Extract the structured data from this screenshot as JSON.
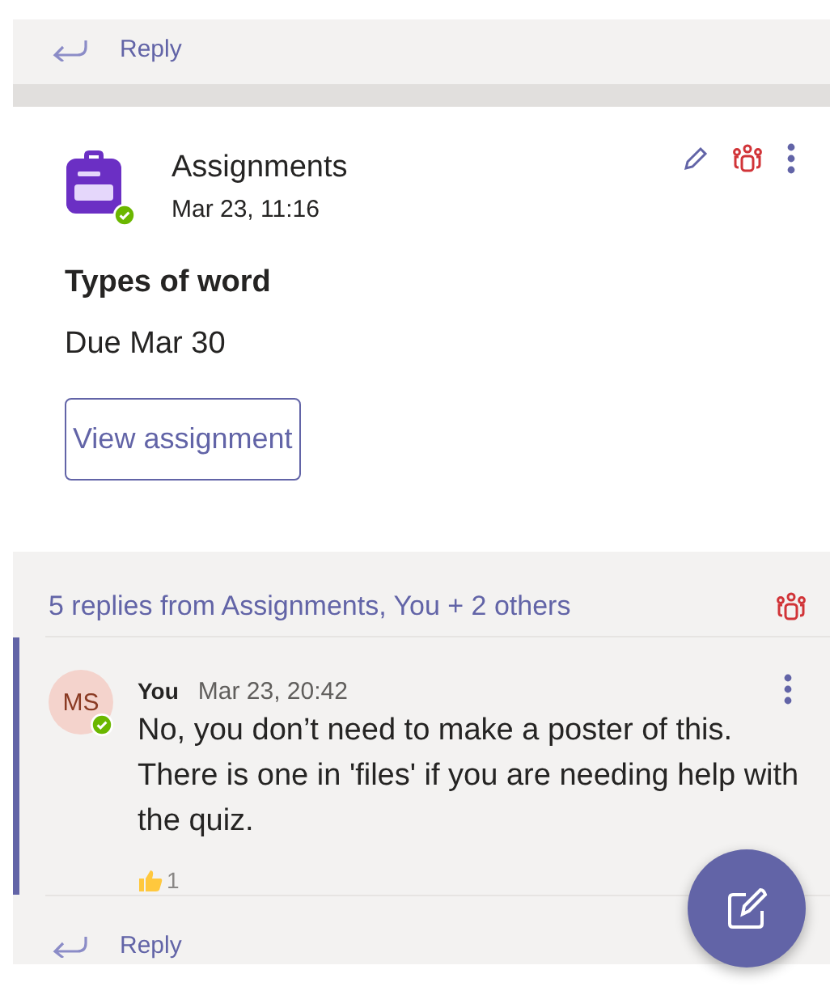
{
  "top_reply": {
    "label": "Reply"
  },
  "post": {
    "author": "Assignments",
    "time": "Mar 23, 11:16",
    "title": "Types of word",
    "due": "Due Mar 30",
    "button": "View assignment"
  },
  "thread": {
    "summary": "5 replies from Assignments, You + 2 others",
    "replies": [
      {
        "author": "You",
        "initials": "MS",
        "time": "Mar 23, 20:42",
        "text": "No, you don’t need to make a poster of this. There is one in 'files' if you are needing help with the quiz.",
        "reaction_count": "1"
      }
    ]
  },
  "bottom_reply": {
    "label": "Reply"
  }
}
